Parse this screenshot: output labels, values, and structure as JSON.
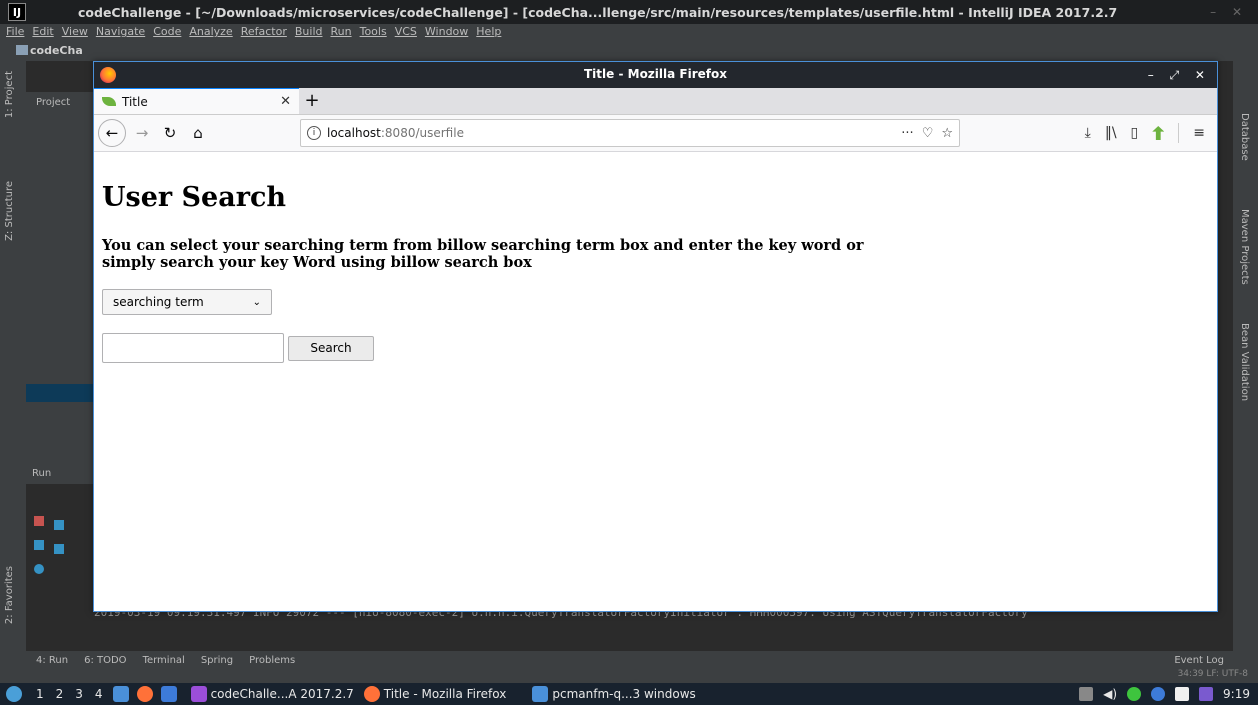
{
  "ide": {
    "window_title": "codeChallenge - [~/Downloads/microservices/codeChallenge] - [codeCha...llenge/src/main/resources/templates/userfile.html - IntelliJ IDEA 2017.2.7",
    "logo_letter": "IJ",
    "menu": [
      "File",
      "Edit",
      "View",
      "Navigate",
      "Code",
      "Analyze",
      "Refactor",
      "Build",
      "Run",
      "Tools",
      "VCS",
      "Window",
      "Help"
    ],
    "nav_project": "codeCha",
    "project_tab": "Project",
    "left_tabs": [
      "1: Project",
      "Z: Structure",
      "2: Favorites"
    ],
    "right_tabs": [
      "Database",
      "Maven Projects",
      "Bean Validation"
    ],
    "run_header": "Run",
    "console_line": "2019-03-19 09:19:31.497  INFO 29072 --- [nio-8080-exec-2] o.h.h.i.QueryTranslatorFactoryInitiator  : HHH000397: Using ASTQueryTranslatorFactory",
    "bottom_tools": [
      "4: Run",
      "6: TODO",
      "Terminal",
      "Spring",
      "Problems"
    ],
    "event_log": "Event Log",
    "status": "34:39  LF:  UTF-8"
  },
  "firefox": {
    "window_title": "Title - Mozilla Firefox",
    "tab_title": "Title",
    "url_host": "localhost",
    "url_path": ":8080/userfile"
  },
  "page": {
    "heading": "User Search",
    "description": "You can select your searching term from billow searching term box and enter the key word or simply search your key Word using billow search box",
    "select_value": "searching term",
    "search_value": "",
    "search_button": "Search"
  },
  "taskbar": {
    "workspaces": [
      "1",
      "2",
      "3",
      "4"
    ],
    "tasks": [
      "codeChalle...A 2017.2.7",
      "Title - Mozilla Firefox",
      "pcmanfm-q...3 windows"
    ],
    "clock": "9:19"
  },
  "colors": {
    "ide_bg": "#2b2b2b",
    "ide_panel": "#3c3f41",
    "firefox_accent": "#0a84ff",
    "spring_green": "#6db33f"
  }
}
